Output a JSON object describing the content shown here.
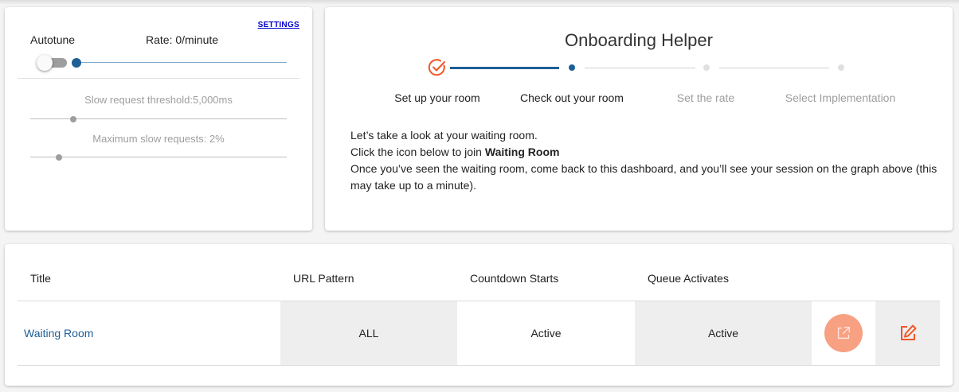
{
  "settings": {
    "settings_link": "SETTINGS",
    "autotune_label": "Autotune",
    "rate_label": "Rate: 0/minute",
    "autotune_enabled": false,
    "slow_threshold_label": "Slow request threshold:5,000ms",
    "slow_threshold_fraction": 0.17,
    "max_slow_label": "Maximum slow requests: 2%",
    "max_slow_fraction": 0.11
  },
  "onboarding": {
    "title": "Onboarding Helper",
    "steps": [
      {
        "label": "Set up your room",
        "state": "done"
      },
      {
        "label": "Check out your room",
        "state": "active"
      },
      {
        "label": "Set the rate",
        "state": "pending"
      },
      {
        "label": "Select Implementation",
        "state": "pending"
      }
    ],
    "text_line1": "Let’s take a look at your waiting room.",
    "text_line2_prefix": "Click the icon below to join ",
    "text_line2_bold": "Waiting Room",
    "text_line3": "Once you’ve seen the waiting room, come back to this dashboard, and you’ll see your session on the graph above (this",
    "text_line4": "may take up to a minute)."
  },
  "table": {
    "headers": {
      "title": "Title",
      "url_pattern": "URL Pattern",
      "countdown": "Countdown Starts",
      "queue": "Queue Activates"
    },
    "rows": [
      {
        "title": "Waiting Room",
        "url_pattern": "ALL",
        "countdown": "Active",
        "queue": "Active",
        "open_icon": "external-link-icon",
        "edit_icon": "edit-icon"
      }
    ]
  },
  "colors": {
    "accent_blue": "#1e5f96",
    "accent_orange": "#f0562b",
    "open_button": "#f7a082",
    "pending_gray": "#9e9e9e"
  }
}
